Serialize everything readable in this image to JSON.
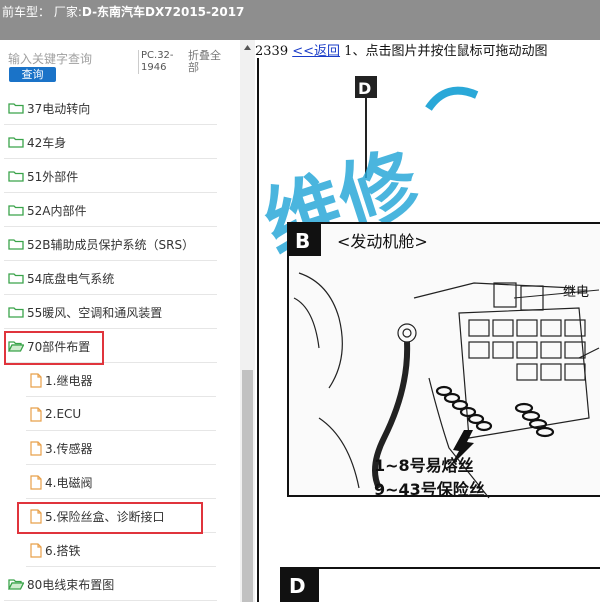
{
  "header": {
    "prefix": "前车型：",
    "maker_label": "厂家:",
    "model": "D-东南汽车DX72015-2017"
  },
  "search": {
    "placeholder": "输入关键字查询",
    "button_label": "查询",
    "pc_code": "PC.32-1946",
    "collapse_label": "折叠全部"
  },
  "tree": {
    "items": [
      {
        "label": "37电动转向",
        "type": "folder"
      },
      {
        "label": "42车身",
        "type": "folder"
      },
      {
        "label": "51外部件",
        "type": "folder"
      },
      {
        "label": "52A内部件",
        "type": "folder"
      },
      {
        "label": "52B辅助成员保护系统（SRS）",
        "type": "folder"
      },
      {
        "label": "54底盘电气系统",
        "type": "folder"
      },
      {
        "label": "55暖风、空调和通风装置",
        "type": "folder"
      },
      {
        "label": "70部件布置",
        "type": "folder-open",
        "highlighted": true
      },
      {
        "label": "1.继电器",
        "type": "doc"
      },
      {
        "label": "2.ECU",
        "type": "doc"
      },
      {
        "label": "3.传感器",
        "type": "doc"
      },
      {
        "label": "4.电磁阀",
        "type": "doc"
      },
      {
        "label": "5.保险丝盒、诊断接口",
        "type": "doc",
        "highlighted": true
      },
      {
        "label": "6.搭铁",
        "type": "doc"
      },
      {
        "label": "80电线束布置图",
        "type": "folder-open"
      }
    ]
  },
  "content": {
    "page_number": "2339",
    "back_label": "<<返回",
    "instruction": "1、点击图片并按住鼠标可拖动动图",
    "watermark": "维修",
    "section_b_letter": "B",
    "section_b_title": "<发动机舱>",
    "relay_label": "继电",
    "fuse_label_1": "1~8号易熔丝",
    "fuse_label_2": "9~43号保险丝",
    "section_d_letter": "D",
    "top_letter": "D"
  },
  "colors": {
    "header_bg": "#8e8e8e",
    "button_bg": "#1a73c8",
    "highlight": "#e0343c",
    "folder": "#3aa34a",
    "doc": "#e8a04a",
    "link": "#1a3cc8",
    "watermark": "#2aa8d8"
  }
}
